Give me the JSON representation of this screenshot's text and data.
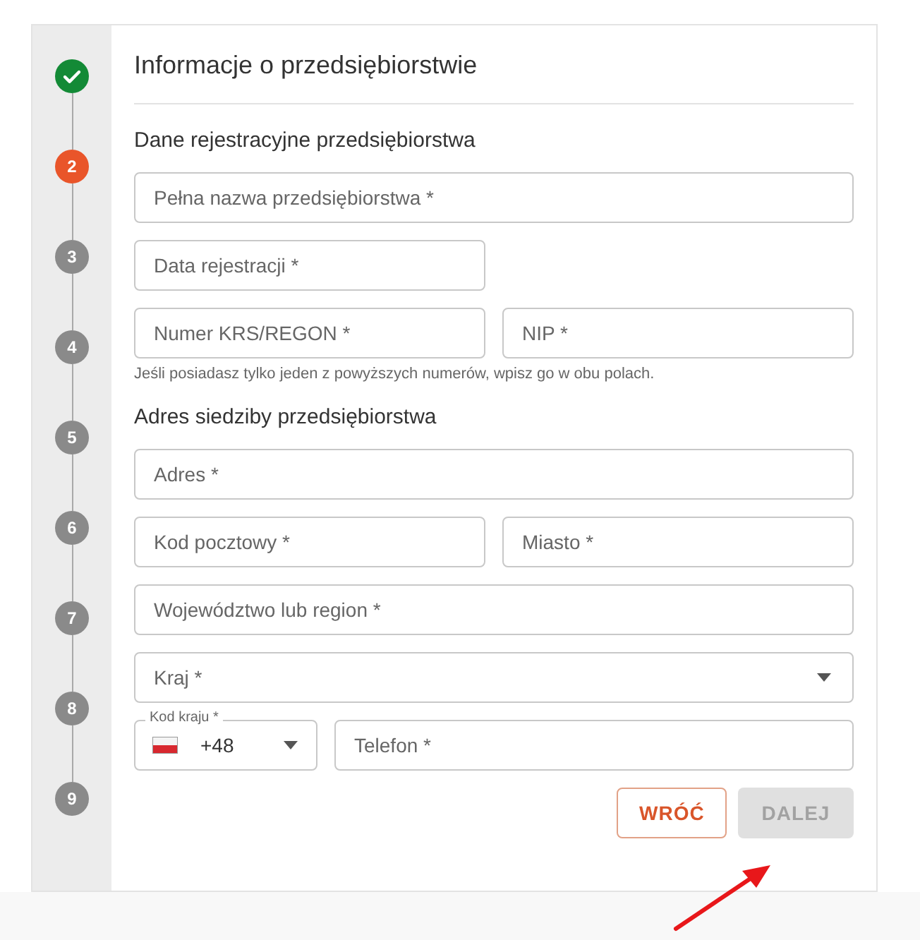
{
  "steps": [
    {
      "completed": true,
      "selected": false
    },
    {
      "label": "2",
      "completed": false,
      "selected": true
    },
    {
      "label": "3",
      "completed": false,
      "selected": false
    },
    {
      "label": "4",
      "completed": false,
      "selected": false
    },
    {
      "label": "5",
      "completed": false,
      "selected": false
    },
    {
      "label": "6",
      "completed": false,
      "selected": false
    },
    {
      "label": "7",
      "completed": false,
      "selected": false
    },
    {
      "label": "8",
      "completed": false,
      "selected": false
    },
    {
      "label": "9",
      "completed": false,
      "selected": false
    }
  ],
  "title": "Informacje o przedsiębiorstwie",
  "sections": [
    {
      "heading": "Dane rejestracyjne przedsiębiorstwa",
      "rows": [
        [
          {
            "kind": "text",
            "placeholder": "Pełna nazwa przedsiębiorstwa *"
          }
        ],
        [
          {
            "kind": "date",
            "placeholder": "Data rejestracji *"
          }
        ],
        [
          {
            "kind": "text",
            "placeholder": "Numer KRS/REGON *"
          },
          {
            "kind": "text",
            "placeholder": "NIP *"
          }
        ]
      ],
      "hint": "Jeśli posiadasz tylko jeden z powyższych numerów, wpisz go w obu polach."
    },
    {
      "heading": "Adres siedziby przedsiębiorstwa",
      "rows": [
        [
          {
            "kind": "text",
            "placeholder": "Adres *"
          }
        ],
        [
          {
            "kind": "text",
            "placeholder": "Kod pocztowy *"
          },
          {
            "kind": "text",
            "placeholder": "Miasto *"
          }
        ],
        [
          {
            "kind": "text",
            "placeholder": "Województwo lub region *"
          }
        ],
        [
          {
            "kind": "select",
            "placeholder": "Kraj *"
          }
        ],
        [
          {
            "kind": "phone-code",
            "label": "Kod kraju *",
            "value": "+48"
          },
          {
            "kind": "phone",
            "placeholder": "Telefon *"
          }
        ]
      ]
    }
  ],
  "buttons": [
    {
      "label": "WRÓĆ",
      "kind": "outline",
      "disabled": false
    },
    {
      "label": "DALEJ",
      "kind": "primary",
      "disabled": true
    }
  ]
}
